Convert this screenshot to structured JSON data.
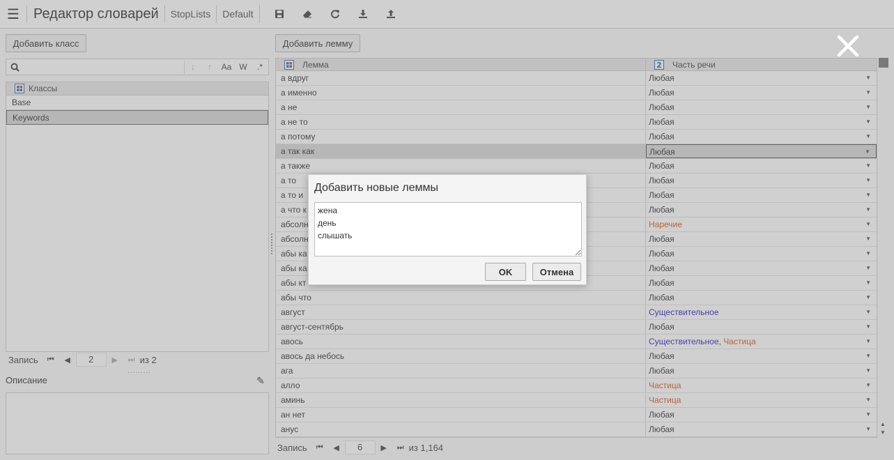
{
  "header": {
    "title": "Редактор словарей",
    "breadcrumbs": [
      "StopLists",
      "Default"
    ],
    "tools": [
      "save-icon",
      "eraser-icon",
      "refresh-icon",
      "download-icon",
      "upload-icon"
    ]
  },
  "left": {
    "add_class_label": "Добавить класс",
    "search": {
      "value": "",
      "placeholder": "",
      "opt_sort_down": "↓",
      "opt_sort_up": "↑",
      "opt_case": "Aa",
      "opt_word": "W",
      "opt_regex": ".*"
    },
    "grid_header": "Классы",
    "items": [
      {
        "label": "Base",
        "selected": false
      },
      {
        "label": "Keywords",
        "selected": true
      }
    ],
    "pager": {
      "record_label": "Запись",
      "current": "2",
      "of_label": "из 2"
    },
    "description_label": "Описание"
  },
  "right": {
    "add_lemma_label": "Добавить лемму",
    "col_lemma": "Лемма",
    "col_pos": "Часть речи",
    "rows": [
      {
        "lemma": "а вдруг",
        "pos": [
          {
            "t": "Любая",
            "k": "any"
          }
        ]
      },
      {
        "lemma": "а именно",
        "pos": [
          {
            "t": "Любая",
            "k": "any"
          }
        ]
      },
      {
        "lemma": "а не",
        "pos": [
          {
            "t": "Любая",
            "k": "any"
          }
        ]
      },
      {
        "lemma": "а не то",
        "pos": [
          {
            "t": "Любая",
            "k": "any"
          }
        ]
      },
      {
        "lemma": "а потому",
        "pos": [
          {
            "t": "Любая",
            "k": "any"
          }
        ]
      },
      {
        "lemma": "а так как",
        "pos": [
          {
            "t": "Любая",
            "k": "any"
          }
        ],
        "selected": true
      },
      {
        "lemma": "а также",
        "pos": [
          {
            "t": "Любая",
            "k": "any"
          }
        ]
      },
      {
        "lemma": "а то",
        "pos": [
          {
            "t": "Любая",
            "k": "any"
          }
        ]
      },
      {
        "lemma": "а то и",
        "pos": [
          {
            "t": "Любая",
            "k": "any"
          }
        ]
      },
      {
        "lemma": "а что к",
        "pos": [
          {
            "t": "Любая",
            "k": "any"
          }
        ]
      },
      {
        "lemma": "абсолн",
        "pos": [
          {
            "t": "Наречие",
            "k": "adv"
          }
        ]
      },
      {
        "lemma": "абсолн",
        "pos": [
          {
            "t": "Любая",
            "k": "any"
          }
        ]
      },
      {
        "lemma": "абы ка",
        "pos": [
          {
            "t": "Любая",
            "k": "any"
          }
        ]
      },
      {
        "lemma": "абы ка",
        "pos": [
          {
            "t": "Любая",
            "k": "any"
          }
        ]
      },
      {
        "lemma": "абы кт",
        "pos": [
          {
            "t": "Любая",
            "k": "any"
          }
        ]
      },
      {
        "lemma": "абы что",
        "pos": [
          {
            "t": "Любая",
            "k": "any"
          }
        ]
      },
      {
        "lemma": "август",
        "pos": [
          {
            "t": "Существительное",
            "k": "noun"
          }
        ]
      },
      {
        "lemma": "август-сентябрь",
        "pos": [
          {
            "t": "Любая",
            "k": "any"
          }
        ]
      },
      {
        "lemma": "авось",
        "pos": [
          {
            "t": "Существительное",
            "k": "noun"
          },
          {
            "t": ", ",
            "k": "any"
          },
          {
            "t": "Частица",
            "k": "part"
          }
        ]
      },
      {
        "lemma": "авось да небось",
        "pos": [
          {
            "t": "Любая",
            "k": "any"
          }
        ]
      },
      {
        "lemma": "ага",
        "pos": [
          {
            "t": "Любая",
            "k": "any"
          }
        ]
      },
      {
        "lemma": "алло",
        "pos": [
          {
            "t": "Частица",
            "k": "part"
          }
        ]
      },
      {
        "lemma": "аминь",
        "pos": [
          {
            "t": "Частица",
            "k": "part"
          }
        ]
      },
      {
        "lemma": "ан нет",
        "pos": [
          {
            "t": "Любая",
            "k": "any"
          }
        ]
      },
      {
        "lemma": "анус",
        "pos": [
          {
            "t": "Любая",
            "k": "any"
          }
        ]
      }
    ],
    "pager": {
      "record_label": "Запись",
      "current": "6",
      "of_label": "из 1,164"
    }
  },
  "dialog": {
    "title": "Добавить новые леммы",
    "text": "жена\nдень\nслышать",
    "ok_label": "OK",
    "cancel_label": "Отмена"
  },
  "colors": {
    "noun": "#2a1ec0",
    "particle": "#d8581b",
    "selected_row": "#d9d9d9"
  }
}
